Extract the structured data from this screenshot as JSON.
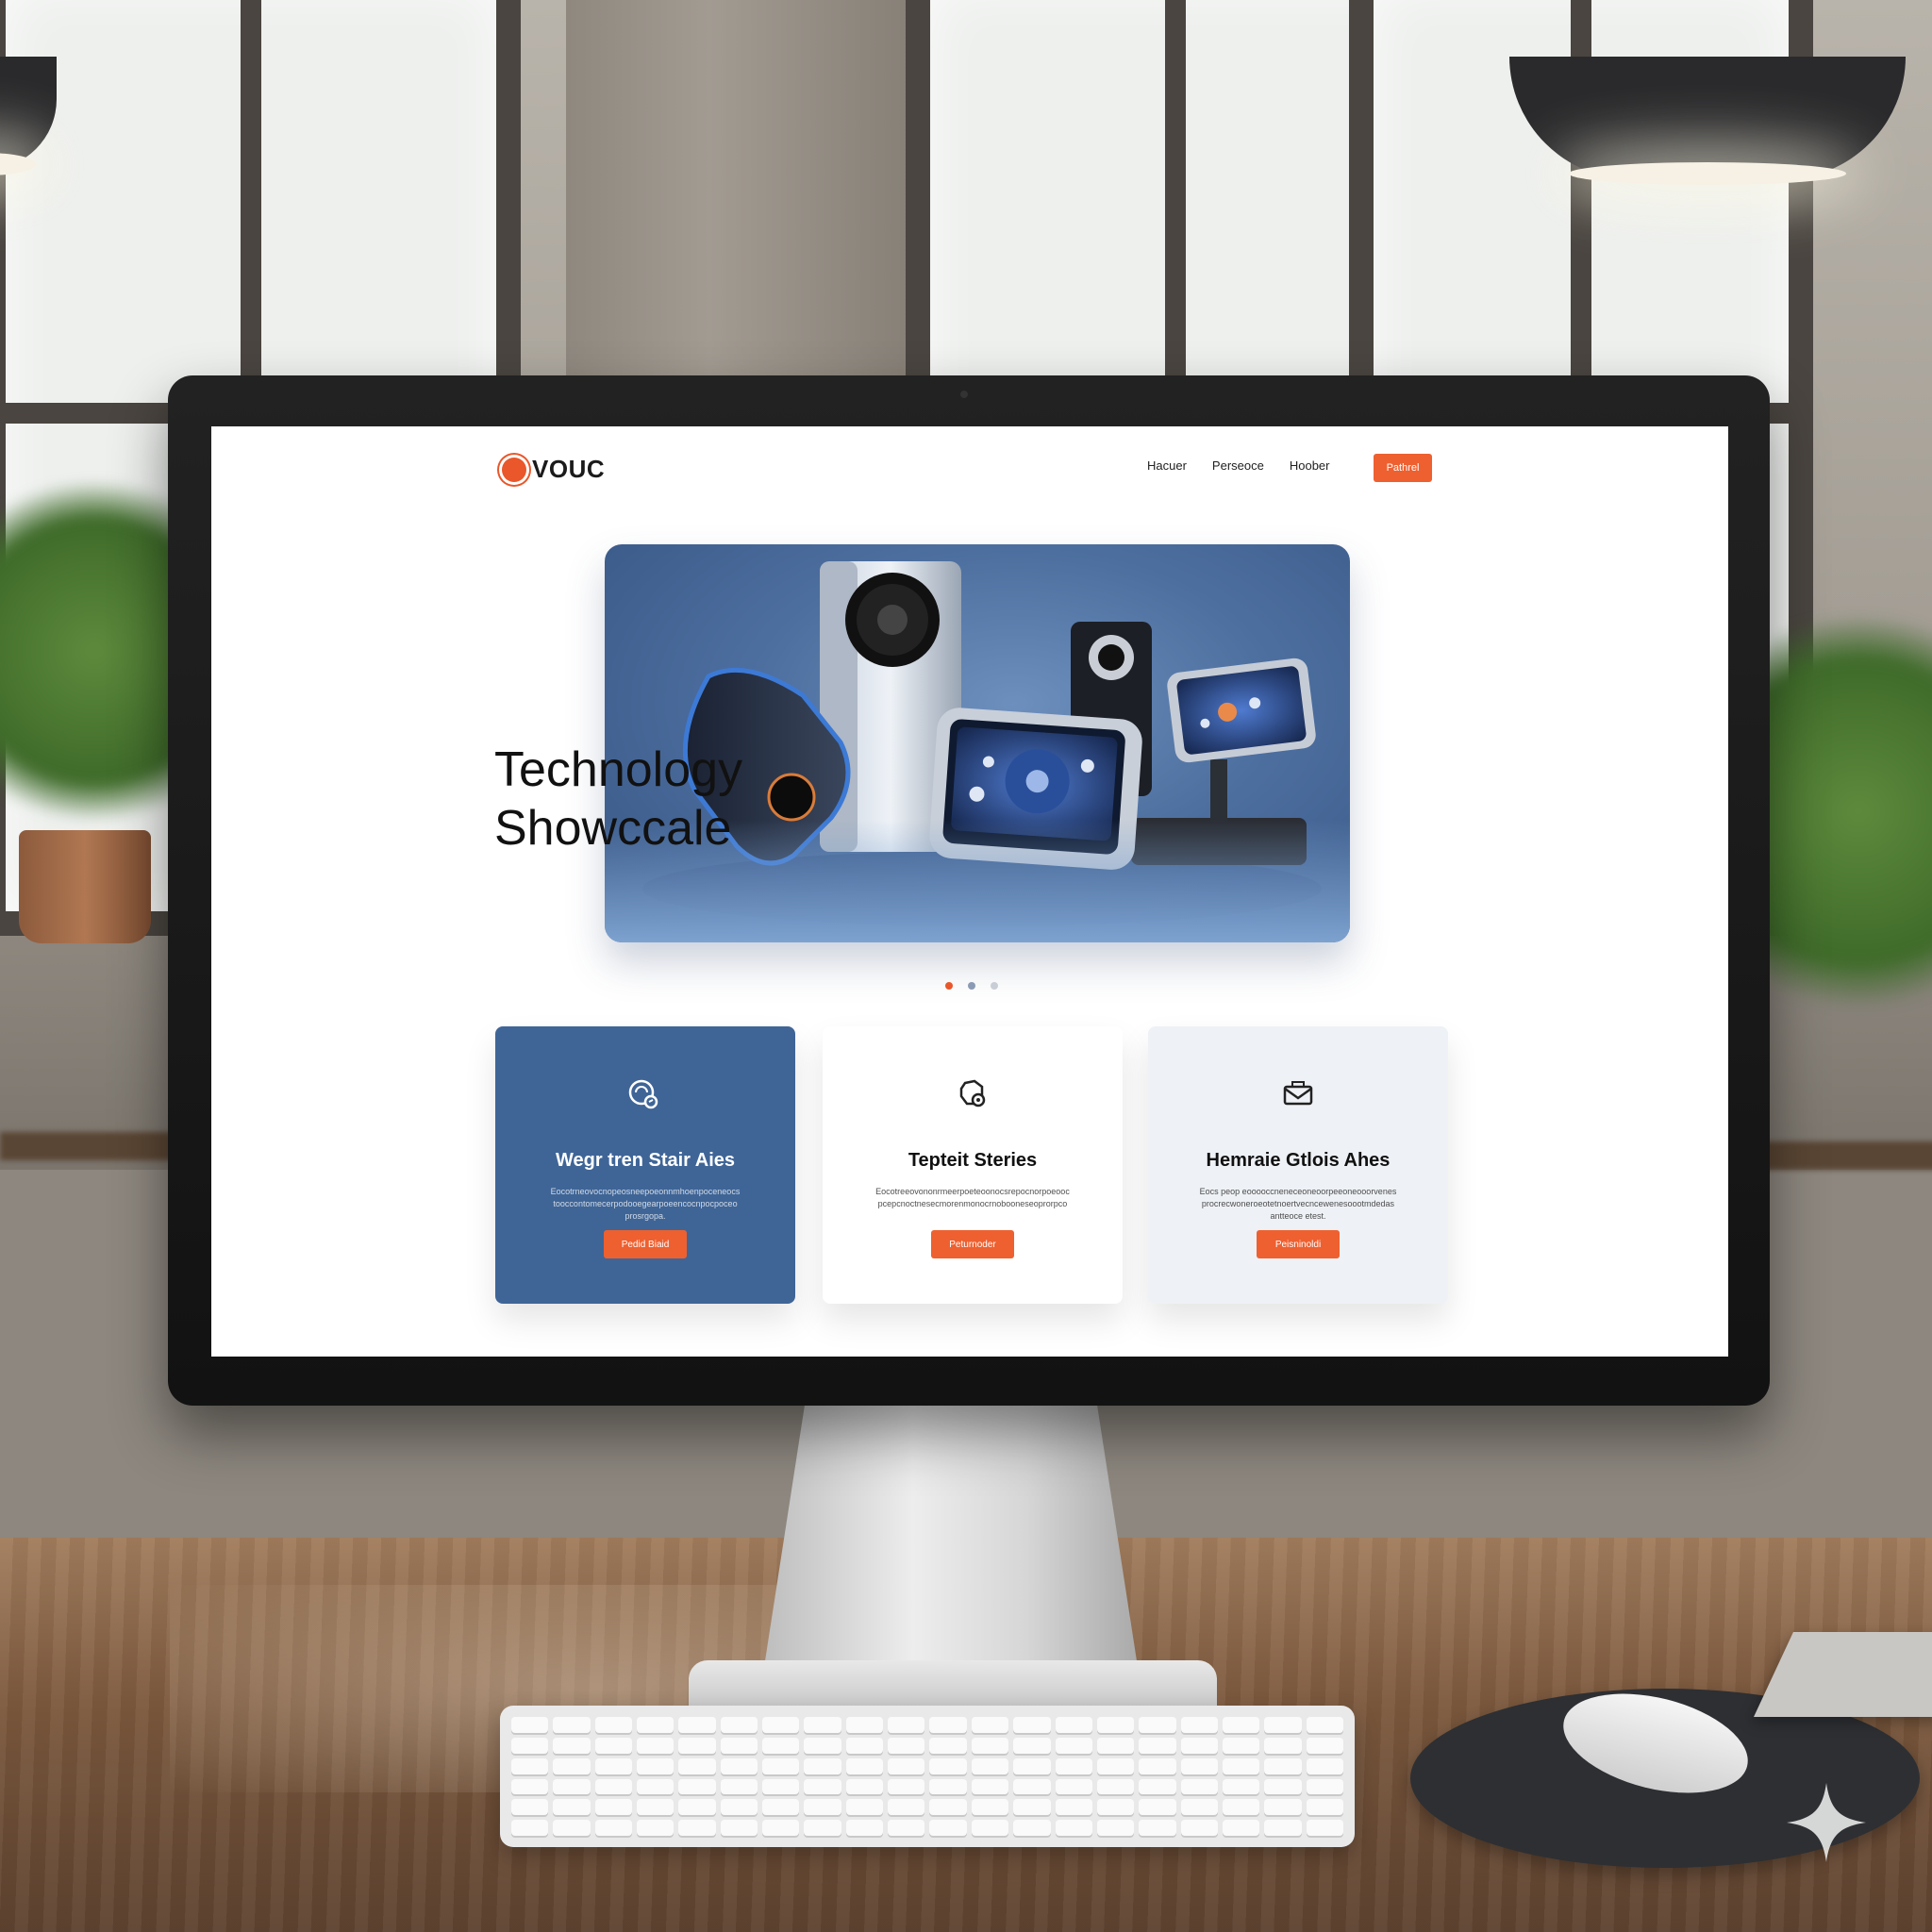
{
  "site": {
    "logo": {
      "text": "VOUC",
      "accent": "#e9572a",
      "icon": "circle-logo-icon"
    },
    "nav": {
      "items": [
        "Hacuer",
        "Perseoce",
        "Hoober"
      ],
      "cta_label": "Pathrel"
    },
    "hero": {
      "title_line1": "Technology",
      "title_line2": "Showccale",
      "slide_count": 3,
      "active_slide": 2
    },
    "pager": {
      "count": 3,
      "active": 1
    },
    "cards": [
      {
        "title": "Wegr tren Stair Aies",
        "body": "Eocotrneovocnopeosneepoeonnmhoenpoceneocs tooccontomecerpodooegearpoeencocnpocpoceo prosrgopa.",
        "button": "Pedid Biaid",
        "icon": "gauge-icon",
        "background": "#3f6597"
      },
      {
        "title": "Tepteit Steries",
        "body": "Eocotreeovononrmeerpoeteoonocsrepocnorpoeooc pcepcnoctnesecmorenmonocrnobooneseoprorpco",
        "button": "Peturnoder",
        "icon": "shield-gear-icon",
        "background": "#ffffff"
      },
      {
        "title": "Hemraie Gtlois Ahes",
        "body": "Eocs peop eooooccneneceoneoorpeeoneooorvenes procrecwoneroeotetnoertvecncewenesoootmdedas antteoce etest.",
        "button": "Peisninoldi",
        "icon": "envelope-icon",
        "background": "#eef1f5"
      }
    ],
    "colors": {
      "brand_orange": "#ee6030",
      "brand_blue": "#3f6597"
    }
  }
}
